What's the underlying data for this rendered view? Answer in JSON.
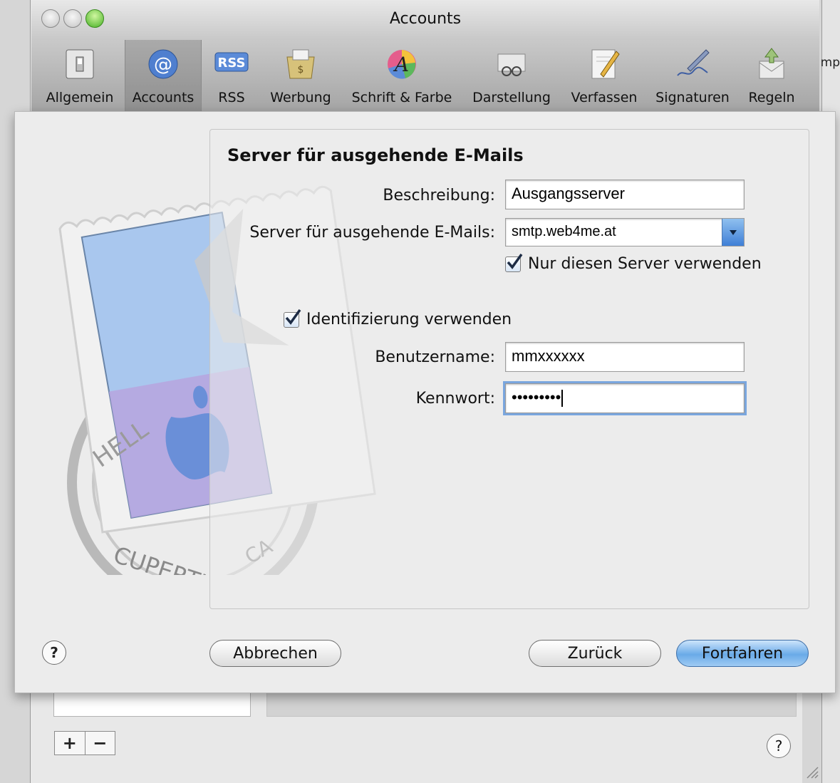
{
  "window": {
    "title": "Accounts",
    "edge_text": "mp"
  },
  "toolbar": {
    "items": [
      {
        "label": "Allgemein",
        "icon": "switch-icon"
      },
      {
        "label": "Accounts",
        "icon": "at-sign-icon",
        "selected": true
      },
      {
        "label": "RSS",
        "icon": "rss-icon"
      },
      {
        "label": "Werbung",
        "icon": "junk-mail-icon"
      },
      {
        "label": "Schrift & Farbe",
        "icon": "font-color-icon"
      },
      {
        "label": "Darstellung",
        "icon": "viewing-glasses-icon"
      },
      {
        "label": "Verfassen",
        "icon": "compose-pencil-icon"
      },
      {
        "label": "Signaturen",
        "icon": "signature-pen-icon"
      },
      {
        "label": "Regeln",
        "icon": "rules-icon"
      }
    ],
    "icon_rss_text": "RSS",
    "icon_at_text": "@"
  },
  "form": {
    "title": "Server für ausgehende E-Mails",
    "description_label": "Beschreibung:",
    "description_value": "Ausgangsserver",
    "server_label": "Server für ausgehende E-Mails:",
    "server_value": "smtp.web4me.at",
    "only_this_server_label": "Nur diesen Server verwenden",
    "only_this_server_checked": true,
    "use_auth_label": "Identifizierung verwenden",
    "use_auth_checked": true,
    "username_label": "Benutzername:",
    "username_value": "mmxxxxxx",
    "password_label": "Kennwort:",
    "password_value": "•••••••••"
  },
  "buttons": {
    "help": "?",
    "cancel": "Abbrechen",
    "back": "Zurück",
    "continue": "Fortfahren"
  },
  "stamp": {
    "top_text": "HELL",
    "bottom_text": "CUPERTINO",
    "ca_text": "CA"
  },
  "background": {
    "plus": "+",
    "minus": "−",
    "help": "?"
  },
  "colors": {
    "accent": "#6aaae8",
    "zoom_button": "#47b025"
  }
}
